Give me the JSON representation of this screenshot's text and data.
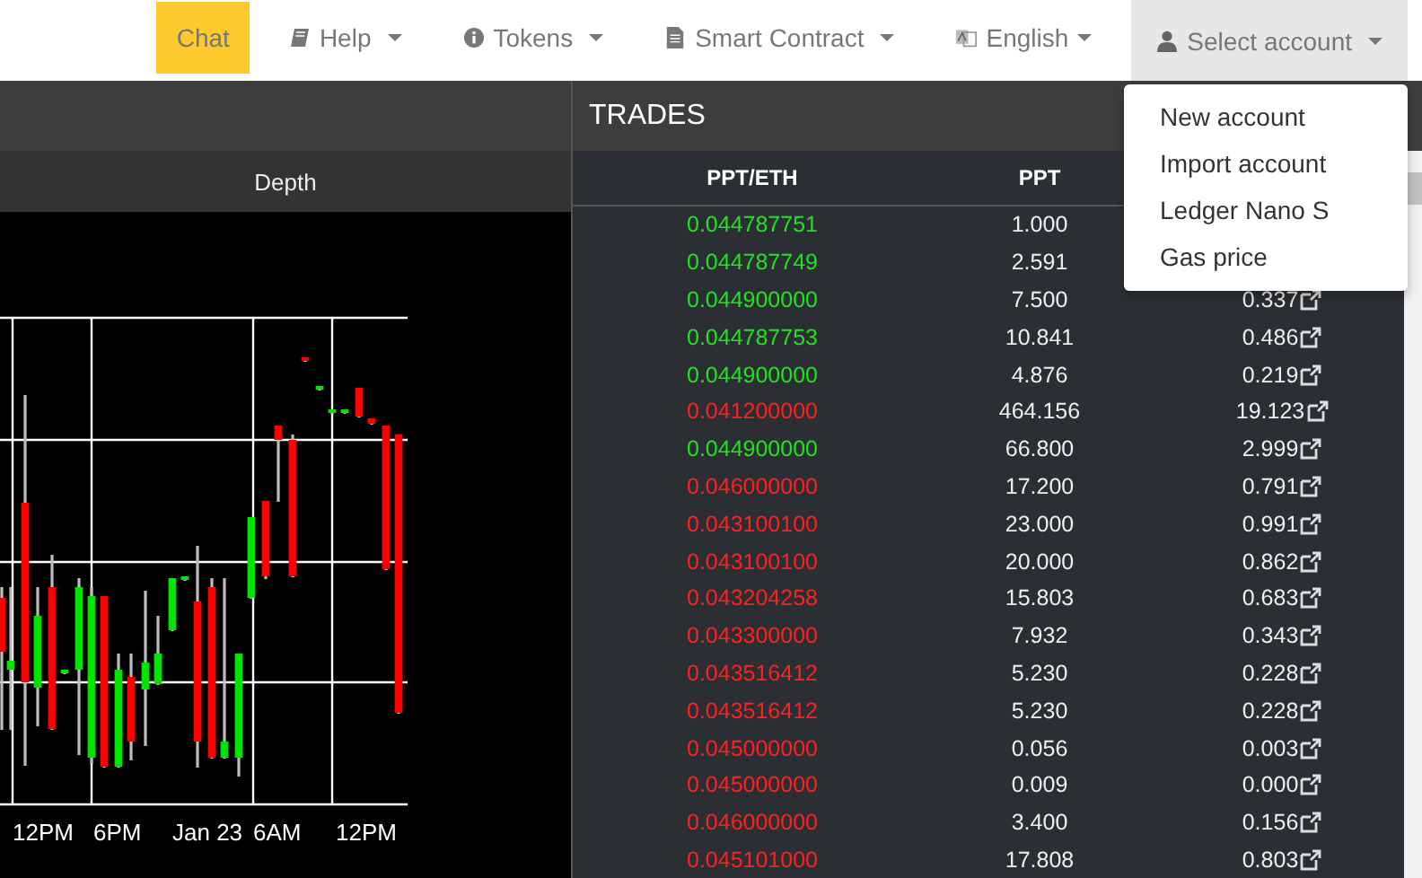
{
  "navbar": {
    "items": [
      {
        "label": "Chat",
        "highlighted": true,
        "has_caret": false,
        "expanded": false
      },
      {
        "label": "Help",
        "highlighted": false,
        "has_caret": true,
        "expanded": false
      },
      {
        "label": "Tokens",
        "highlighted": false,
        "has_caret": true,
        "expanded": false
      },
      {
        "label": "Smart Contract",
        "highlighted": false,
        "has_caret": true,
        "expanded": false
      },
      {
        "label": "English",
        "highlighted": false,
        "has_caret": true,
        "expanded": false
      },
      {
        "label": "Select account",
        "highlighted": false,
        "has_caret": true,
        "expanded": true
      }
    ]
  },
  "account_menu": {
    "items": [
      "New account",
      "Import account",
      "Ledger Nano S",
      "Gas price"
    ]
  },
  "chart_panel": {
    "tab": "Depth",
    "x_axis_labels": [
      "12PM",
      "6PM",
      "Jan 23",
      "6AM",
      "12PM"
    ]
  },
  "trades": {
    "title": "TRADES",
    "columns": [
      "PPT/ETH",
      "PPT"
    ],
    "rows": [
      {
        "price": "0.044787751",
        "amount": "1.000",
        "color": "#22e022"
      },
      {
        "price": "0.044787749",
        "amount": "2.591",
        "color": "#22e022"
      },
      {
        "price": "0.044900000",
        "amount": "7.500",
        "total": "0.337",
        "color": "#22e022"
      },
      {
        "price": "0.044787753",
        "amount": "10.841",
        "total": "0.486",
        "color": "#22e022"
      },
      {
        "price": "0.044900000",
        "amount": "4.876",
        "total": "0.219",
        "color": "#22e022"
      },
      {
        "price": "0.041200000",
        "amount": "464.156",
        "total": "19.123",
        "color": "#ff2020"
      },
      {
        "price": "0.044900000",
        "amount": "66.800",
        "total": "2.999",
        "color": "#22e022"
      },
      {
        "price": "0.046000000",
        "amount": "17.200",
        "total": "0.791",
        "color": "#ff2020"
      },
      {
        "price": "0.043100100",
        "amount": "23.000",
        "total": "0.991",
        "color": "#ff2020"
      },
      {
        "price": "0.043100100",
        "amount": "20.000",
        "total": "0.862",
        "color": "#ff2020"
      },
      {
        "price": "0.043204258",
        "amount": "15.803",
        "total": "0.683",
        "color": "#ff2020"
      },
      {
        "price": "0.043300000",
        "amount": "7.932",
        "total": "0.343",
        "color": "#ff2020"
      },
      {
        "price": "0.043516412",
        "amount": "5.230",
        "total": "0.228",
        "color": "#ff2020"
      },
      {
        "price": "0.043516412",
        "amount": "5.230",
        "total": "0.228",
        "color": "#ff2020"
      },
      {
        "price": "0.045000000",
        "amount": "0.056",
        "total": "0.003",
        "color": "#ff2020"
      },
      {
        "price": "0.045000000",
        "amount": "0.009",
        "total": "0.000",
        "color": "#ff2020"
      },
      {
        "price": "0.046000000",
        "amount": "3.400",
        "total": "0.156",
        "color": "#ff2020"
      },
      {
        "price": "0.045101000",
        "amount": "17.808",
        "total": "0.803",
        "color": "#ff2020"
      }
    ]
  }
}
